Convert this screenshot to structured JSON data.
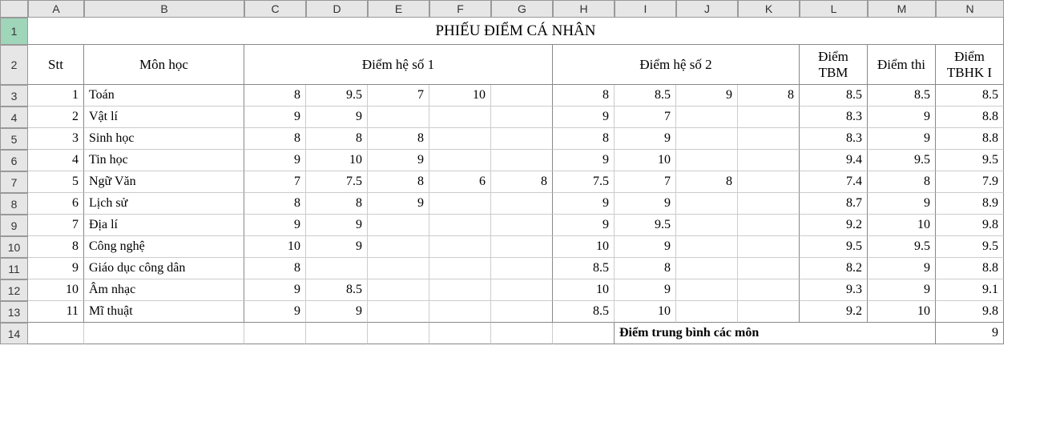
{
  "columns": [
    "A",
    "B",
    "C",
    "D",
    "E",
    "F",
    "G",
    "H",
    "I",
    "J",
    "K",
    "L",
    "M",
    "N"
  ],
  "rowNumbers": [
    1,
    2,
    3,
    4,
    5,
    6,
    7,
    8,
    9,
    10,
    11,
    12,
    13,
    14
  ],
  "title": "PHIẾU ĐIỂM CÁ NHÂN",
  "headers": {
    "stt": "Stt",
    "mon": "Môn học",
    "hs1": "Điểm hệ số 1",
    "hs2": "Điểm hệ số 2",
    "tbm": "Điểm TBM",
    "thi": "Điểm thi",
    "tbhk": "Điểm TBHK I"
  },
  "rows": [
    {
      "stt": 1,
      "mon": "Toán",
      "c": 8,
      "d": 9.5,
      "e": 7,
      "f": 10,
      "g": "",
      "h": 8,
      "i": 8.5,
      "j": 9,
      "k": 8,
      "l": 8.5,
      "m": 8.5,
      "n": 8.5
    },
    {
      "stt": 2,
      "mon": "Vật lí",
      "c": 9,
      "d": 9,
      "e": "",
      "f": "",
      "g": "",
      "h": 9,
      "i": 7,
      "j": "",
      "k": "",
      "l": 8.3,
      "m": 9,
      "n": 8.8
    },
    {
      "stt": 3,
      "mon": "Sinh học",
      "c": 8,
      "d": 8,
      "e": 8,
      "f": "",
      "g": "",
      "h": 8,
      "i": 9,
      "j": "",
      "k": "",
      "l": 8.3,
      "m": 9,
      "n": 8.8
    },
    {
      "stt": 4,
      "mon": "Tin học",
      "c": 9,
      "d": 10,
      "e": 9,
      "f": "",
      "g": "",
      "h": 9,
      "i": 10,
      "j": "",
      "k": "",
      "l": 9.4,
      "m": 9.5,
      "n": 9.5
    },
    {
      "stt": 5,
      "mon": "Ngữ Văn",
      "c": 7,
      "d": 7.5,
      "e": 8,
      "f": 6,
      "g": 8,
      "h": 7.5,
      "i": 7,
      "j": 8,
      "k": "",
      "l": 7.4,
      "m": 8,
      "n": 7.9
    },
    {
      "stt": 6,
      "mon": "Lịch sử",
      "c": 8,
      "d": 8,
      "e": 9,
      "f": "",
      "g": "",
      "h": 9,
      "i": 9,
      "j": "",
      "k": "",
      "l": 8.7,
      "m": 9,
      "n": 8.9
    },
    {
      "stt": 7,
      "mon": "Địa lí",
      "c": 9,
      "d": 9,
      "e": "",
      "f": "",
      "g": "",
      "h": 9,
      "i": 9.5,
      "j": "",
      "k": "",
      "l": 9.2,
      "m": 10,
      "n": 9.8
    },
    {
      "stt": 8,
      "mon": "Công nghệ",
      "c": 10,
      "d": 9,
      "e": "",
      "f": "",
      "g": "",
      "h": 10,
      "i": 9,
      "j": "",
      "k": "",
      "l": 9.5,
      "m": 9.5,
      "n": 9.5
    },
    {
      "stt": 9,
      "mon": "Giáo dục công dân",
      "c": 8,
      "d": "",
      "e": "",
      "f": "",
      "g": "",
      "h": 8.5,
      "i": 8,
      "j": "",
      "k": "",
      "l": 8.2,
      "m": 9,
      "n": 8.8
    },
    {
      "stt": 10,
      "mon": "Âm nhạc",
      "c": 9,
      "d": 8.5,
      "e": "",
      "f": "",
      "g": "",
      "h": 10,
      "i": 9,
      "j": "",
      "k": "",
      "l": 9.3,
      "m": 9,
      "n": 9.1
    },
    {
      "stt": 11,
      "mon": "Mĩ thuật",
      "c": 9,
      "d": 9,
      "e": "",
      "f": "",
      "g": "",
      "h": 8.5,
      "i": 10,
      "j": "",
      "k": "",
      "l": 9.2,
      "m": 10,
      "n": 9.8
    }
  ],
  "footer": {
    "label": "Điểm trung bình các môn",
    "value": 9
  }
}
